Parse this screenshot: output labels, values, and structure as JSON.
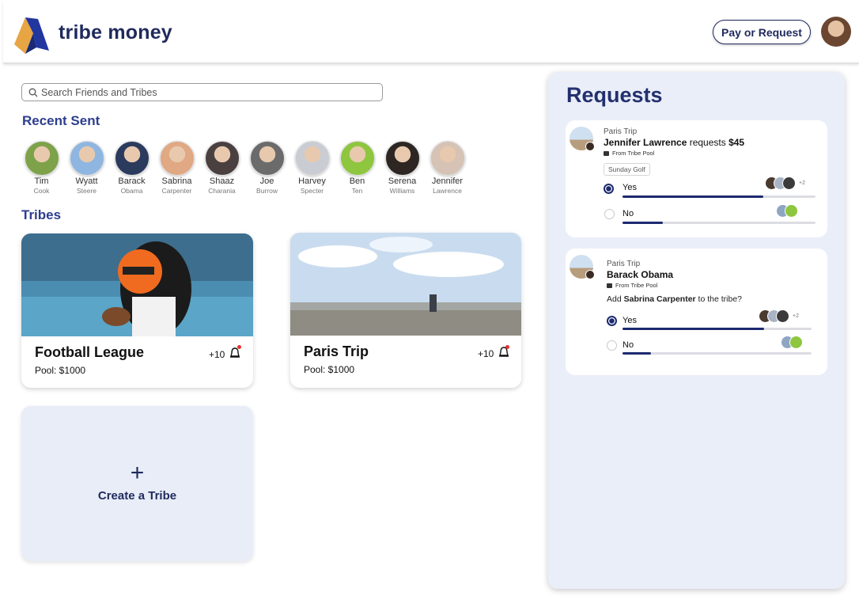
{
  "header": {
    "brand": "tribe money",
    "pay_button": "Pay or Request"
  },
  "search": {
    "placeholder": "Search Friends and Tribes"
  },
  "recent_sent": {
    "title": "Recent Sent",
    "friends": [
      {
        "first": "Tim",
        "last": "Cook",
        "color": "#7da24a"
      },
      {
        "first": "Wyatt",
        "last": "Steere",
        "color": "#8fb6e0"
      },
      {
        "first": "Barack",
        "last": "Obama",
        "color": "#2b3b5e"
      },
      {
        "first": "Sabrina",
        "last": "Carpenter",
        "color": "#e0a883"
      },
      {
        "first": "Shaaz",
        "last": "Charania",
        "color": "#4a4040"
      },
      {
        "first": "Joe",
        "last": "Burrow",
        "color": "#6b6b6b"
      },
      {
        "first": "Harvey",
        "last": "Specter",
        "color": "#c9ccd3"
      },
      {
        "first": "Ben",
        "last": "Ten",
        "color": "#8ec63f"
      },
      {
        "first": "Serena",
        "last": "Williams",
        "color": "#2d2622"
      },
      {
        "first": "Jennifer",
        "last": "Lawrence",
        "color": "#d6c3b5"
      }
    ]
  },
  "tribes": {
    "title": "Tribes",
    "cards": [
      {
        "name": "Football League",
        "pool": "Pool: $1000",
        "count": "+10"
      },
      {
        "name": "Paris Trip",
        "pool": "Pool: $1000",
        "count": "+10"
      }
    ],
    "create_label": "Create a Tribe",
    "create_icon": "+"
  },
  "requests": {
    "title": "Requests",
    "items": [
      {
        "trip": "Paris Trip",
        "name": "Jennifer Lawrence",
        "action": " requests ",
        "amount": "$45",
        "from": "From Tribe Pool",
        "tag": "Sunday Golf",
        "yes_label": "Yes",
        "no_label": "No",
        "yes_share": 0.73,
        "no_share": 0.21,
        "yes_more": "+2"
      },
      {
        "trip": "Paris Trip",
        "name": "Barack Obama",
        "from": "From Tribe Pool",
        "question_pre": "Add ",
        "question_name": "Sabrina Carpenter",
        "question_post": " to the tribe?",
        "yes_label": "Yes",
        "no_label": "No",
        "yes_share": 0.75,
        "no_share": 0.15,
        "yes_more": "+2"
      }
    ]
  }
}
